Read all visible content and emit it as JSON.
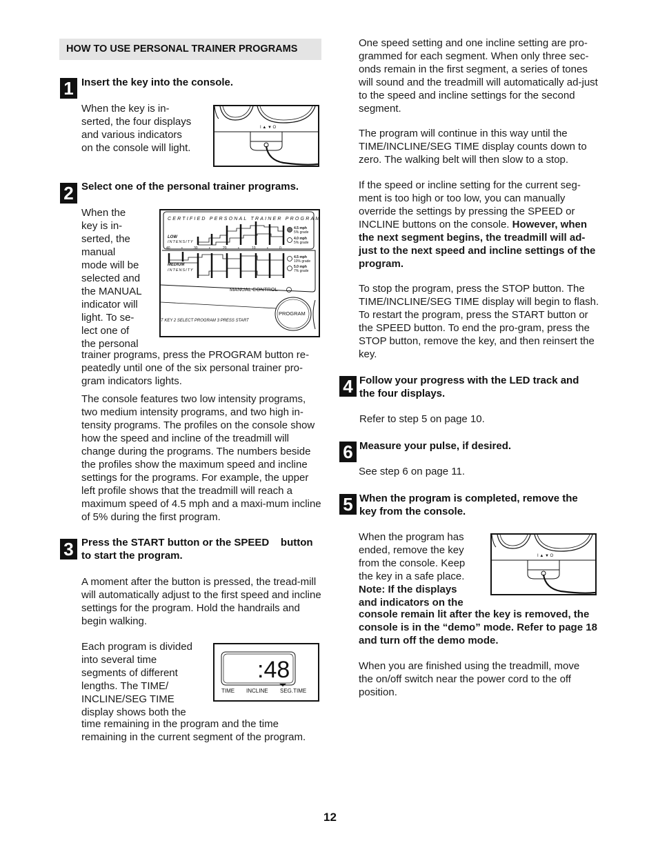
{
  "section_title": "HOW TO USE PERSONAL TRAINER PROGRAMS",
  "steps": [
    {
      "number": "1",
      "title": "Insert the key into the console.",
      "paragraphs": [
        "When the key is in-",
        "serted, the four displays",
        "and various indicators",
        "on the console will light."
      ]
    },
    {
      "number": "2",
      "title": "Select one of the personal trainer programs.",
      "wrap_lines": [
        "When the",
        "key is in-",
        "serted, the",
        "manual",
        "mode will be",
        "selected and",
        "the MANUAL",
        "indicator will",
        "light. To se-",
        "lect one of",
        "the personal"
      ],
      "continuation": "trainer programs, press the PROGRAM button re-peatedly until one of the six personal trainer pro-gram indicators lights.",
      "paragraph2": "The console features two low intensity programs, two medium intensity programs, and two high in-tensity programs. The profiles on the console show how the speed and incline of the treadmill will change during the programs. The numbers beside the profiles show the maximum speed and incline settings for the programs. For example, the upper left profile shows that the treadmill will reach a maximum speed of 4.5 mph and a maxi-mum incline of 5% during the first program."
    },
    {
      "number": "3",
      "title_line1": "Press the START button or the SPEED    button",
      "title_line2": "to start the program.",
      "paragraph1": "A moment after the button is pressed, the tread-mill will automatically adjust to the first speed and incline settings for the program. Hold the handrails and begin walking.",
      "wrap_lines": [
        "Each program is divided",
        "into several time",
        "segments of different",
        "lengths. The TIME/",
        "INCLINE/SEG TIME",
        "display shows both the"
      ],
      "continuation": "time remaining in the program and the time remaining in the current segment of the program."
    },
    {
      "number": "4",
      "title": "Follow your progress with the LED track and the four displays.",
      "body": "Refer to step 5 on page 10."
    },
    {
      "number": "6",
      "title": "Measure your pulse, if desired.",
      "body": "See step 6 on page 11."
    },
    {
      "number": "5",
      "title": "When the program is completed, remove the key from the console.",
      "wrap_lines": [
        "When the program has",
        "ended, remove the key",
        "from the console. Keep",
        "the key in a safe place."
      ],
      "note_wrap": [
        "Note: If the displays",
        "and indicators on the"
      ],
      "note_continuation": "console remain lit after the key is removed, the console is in the “demo” mode. Refer to page 18 and turn off the demo mode.",
      "final": "When you are finished using the treadmill, move the on/off switch near the power cord to the off position."
    }
  ],
  "right_column": {
    "p1": "One speed setting and one incline setting are pro-grammed for each segment. When only three sec-onds remain in the first segment, a series of tones will sound and the treadmill will automatically ad-just to the speed and incline settings for the second segment.",
    "p2": "The program will continue in this way until the TIME/INCLINE/SEG TIME display counts down to zero. The walking belt will then slow to a stop.",
    "p3_normal": "If the speed or incline setting for the current seg-ment is too high or too low, you can manually override the settings by pressing the SPEED or INCLINE buttons on the console. ",
    "p3_bold": "However, when the next segment begins, the treadmill will ad-just to the next speed and incline settings of the program.",
    "p4": "To stop the program, press the STOP button. The TIME/INCLINE/SEG TIME display will begin to flash. To restart the program, press the START button or the SPEED    button. To end the pro-gram, press the STOP button, remove the key, and then reinsert the key."
  },
  "figures": {
    "key_panel": {
      "indicator_labels": "I ▲   ▼ O"
    },
    "program_panel": {
      "banner": "CERTIFIED PERSONAL TRAINER PROGRAMS",
      "low_label": "LOW",
      "low_sub": "INTENSITY",
      "medium_label": "MEDIUM",
      "medium_sub": "INTENSITY",
      "scale": [
        "40",
        "•",
        "30",
        "•",
        "20",
        "•",
        "10",
        "•",
        "0"
      ],
      "settings": [
        {
          "speed": "4.5 mph",
          "grade": "5% grade"
        },
        {
          "speed": "4.0 mph",
          "grade": "5% grade"
        },
        {
          "speed": "4.5 mph",
          "grade": "10% grade"
        },
        {
          "speed": "5.0 mph",
          "grade": "7% grade"
        }
      ],
      "manual_control": "MANUAL CONTROL",
      "program_button": "PROGRAM",
      "instruction_strip": "T KEY 2 SELECT PROGRAM 3 PRESS START"
    },
    "display": {
      "value": ":48",
      "labels": [
        "TIME",
        "INCLINE",
        "SEG.TIME"
      ]
    }
  },
  "page_number": "12"
}
